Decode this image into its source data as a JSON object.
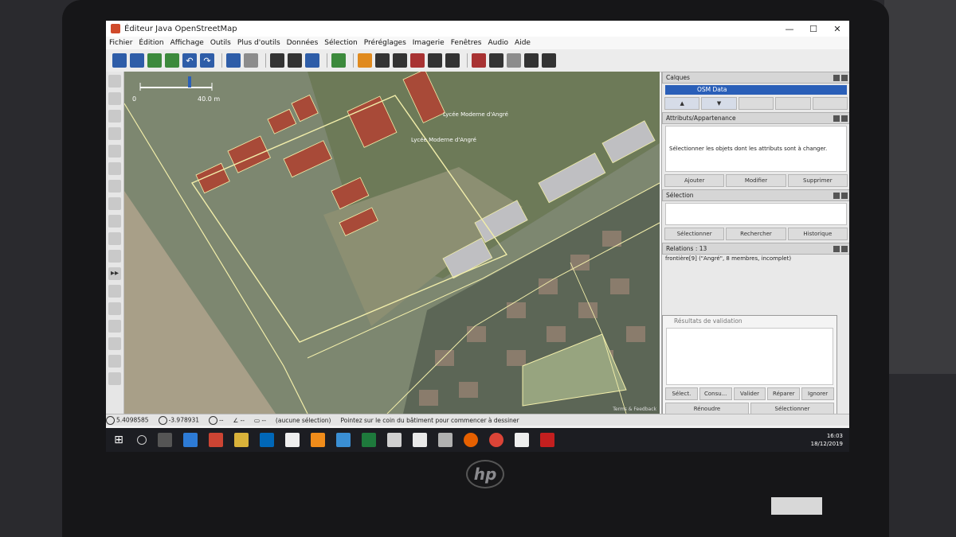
{
  "window": {
    "title": "Éditeur Java OpenStreetMap",
    "controls": [
      "—",
      "☐",
      "✕"
    ]
  },
  "menu": [
    "Fichier",
    "Édition",
    "Affichage",
    "Outils",
    "Plus d'outils",
    "Données",
    "Sélection",
    "Préréglages",
    "Imagerie",
    "Fenêtres",
    "Audio",
    "Aide"
  ],
  "map": {
    "scale_label": "40.0 m",
    "scale_start": "0",
    "labels": [
      "Lycée Moderne d'Angré",
      "Lycée Moderne d'Angré"
    ],
    "attribution": "Terms & Feedback"
  },
  "panels": {
    "layers": {
      "title": "Calques",
      "layer_name": "OSM Data"
    },
    "attributes": {
      "title": "Attributs/Appartenance",
      "hint": "Sélectionner les objets dont les attributs sont à changer.",
      "buttons": [
        "Ajouter",
        "Modifier",
        "Supprimer"
      ]
    },
    "selection": {
      "title": "Sélection",
      "buttons": [
        "Sélectionner",
        "Rechercher",
        "Historique"
      ]
    },
    "relations": {
      "title": "Relations : 13",
      "rows": [
        "frontière[9] (\"Angré\", 8 membres, incomplet)"
      ]
    },
    "validation": {
      "title": "Résultats de validation",
      "buttons": [
        "Sélect.",
        "Consu...",
        "Valider",
        "Réparer",
        "Ignorer"
      ],
      "bottom_buttons": [
        "Rénoudre",
        "Sélectionner"
      ]
    }
  },
  "status": {
    "lat": "5.4098585",
    "lon": "-3.978931",
    "heading": "--",
    "angle": "--",
    "length": "--",
    "selection": "(aucune sélection)",
    "message": "Pointez sur le coin du bâtiment pour commencer à dessiner"
  },
  "taskbar": {
    "time": "16:03",
    "date": "18/12/2019"
  },
  "colors": {
    "accent": "#2a5fb8",
    "way": "#f2eeaa",
    "building": "#a84a38"
  }
}
